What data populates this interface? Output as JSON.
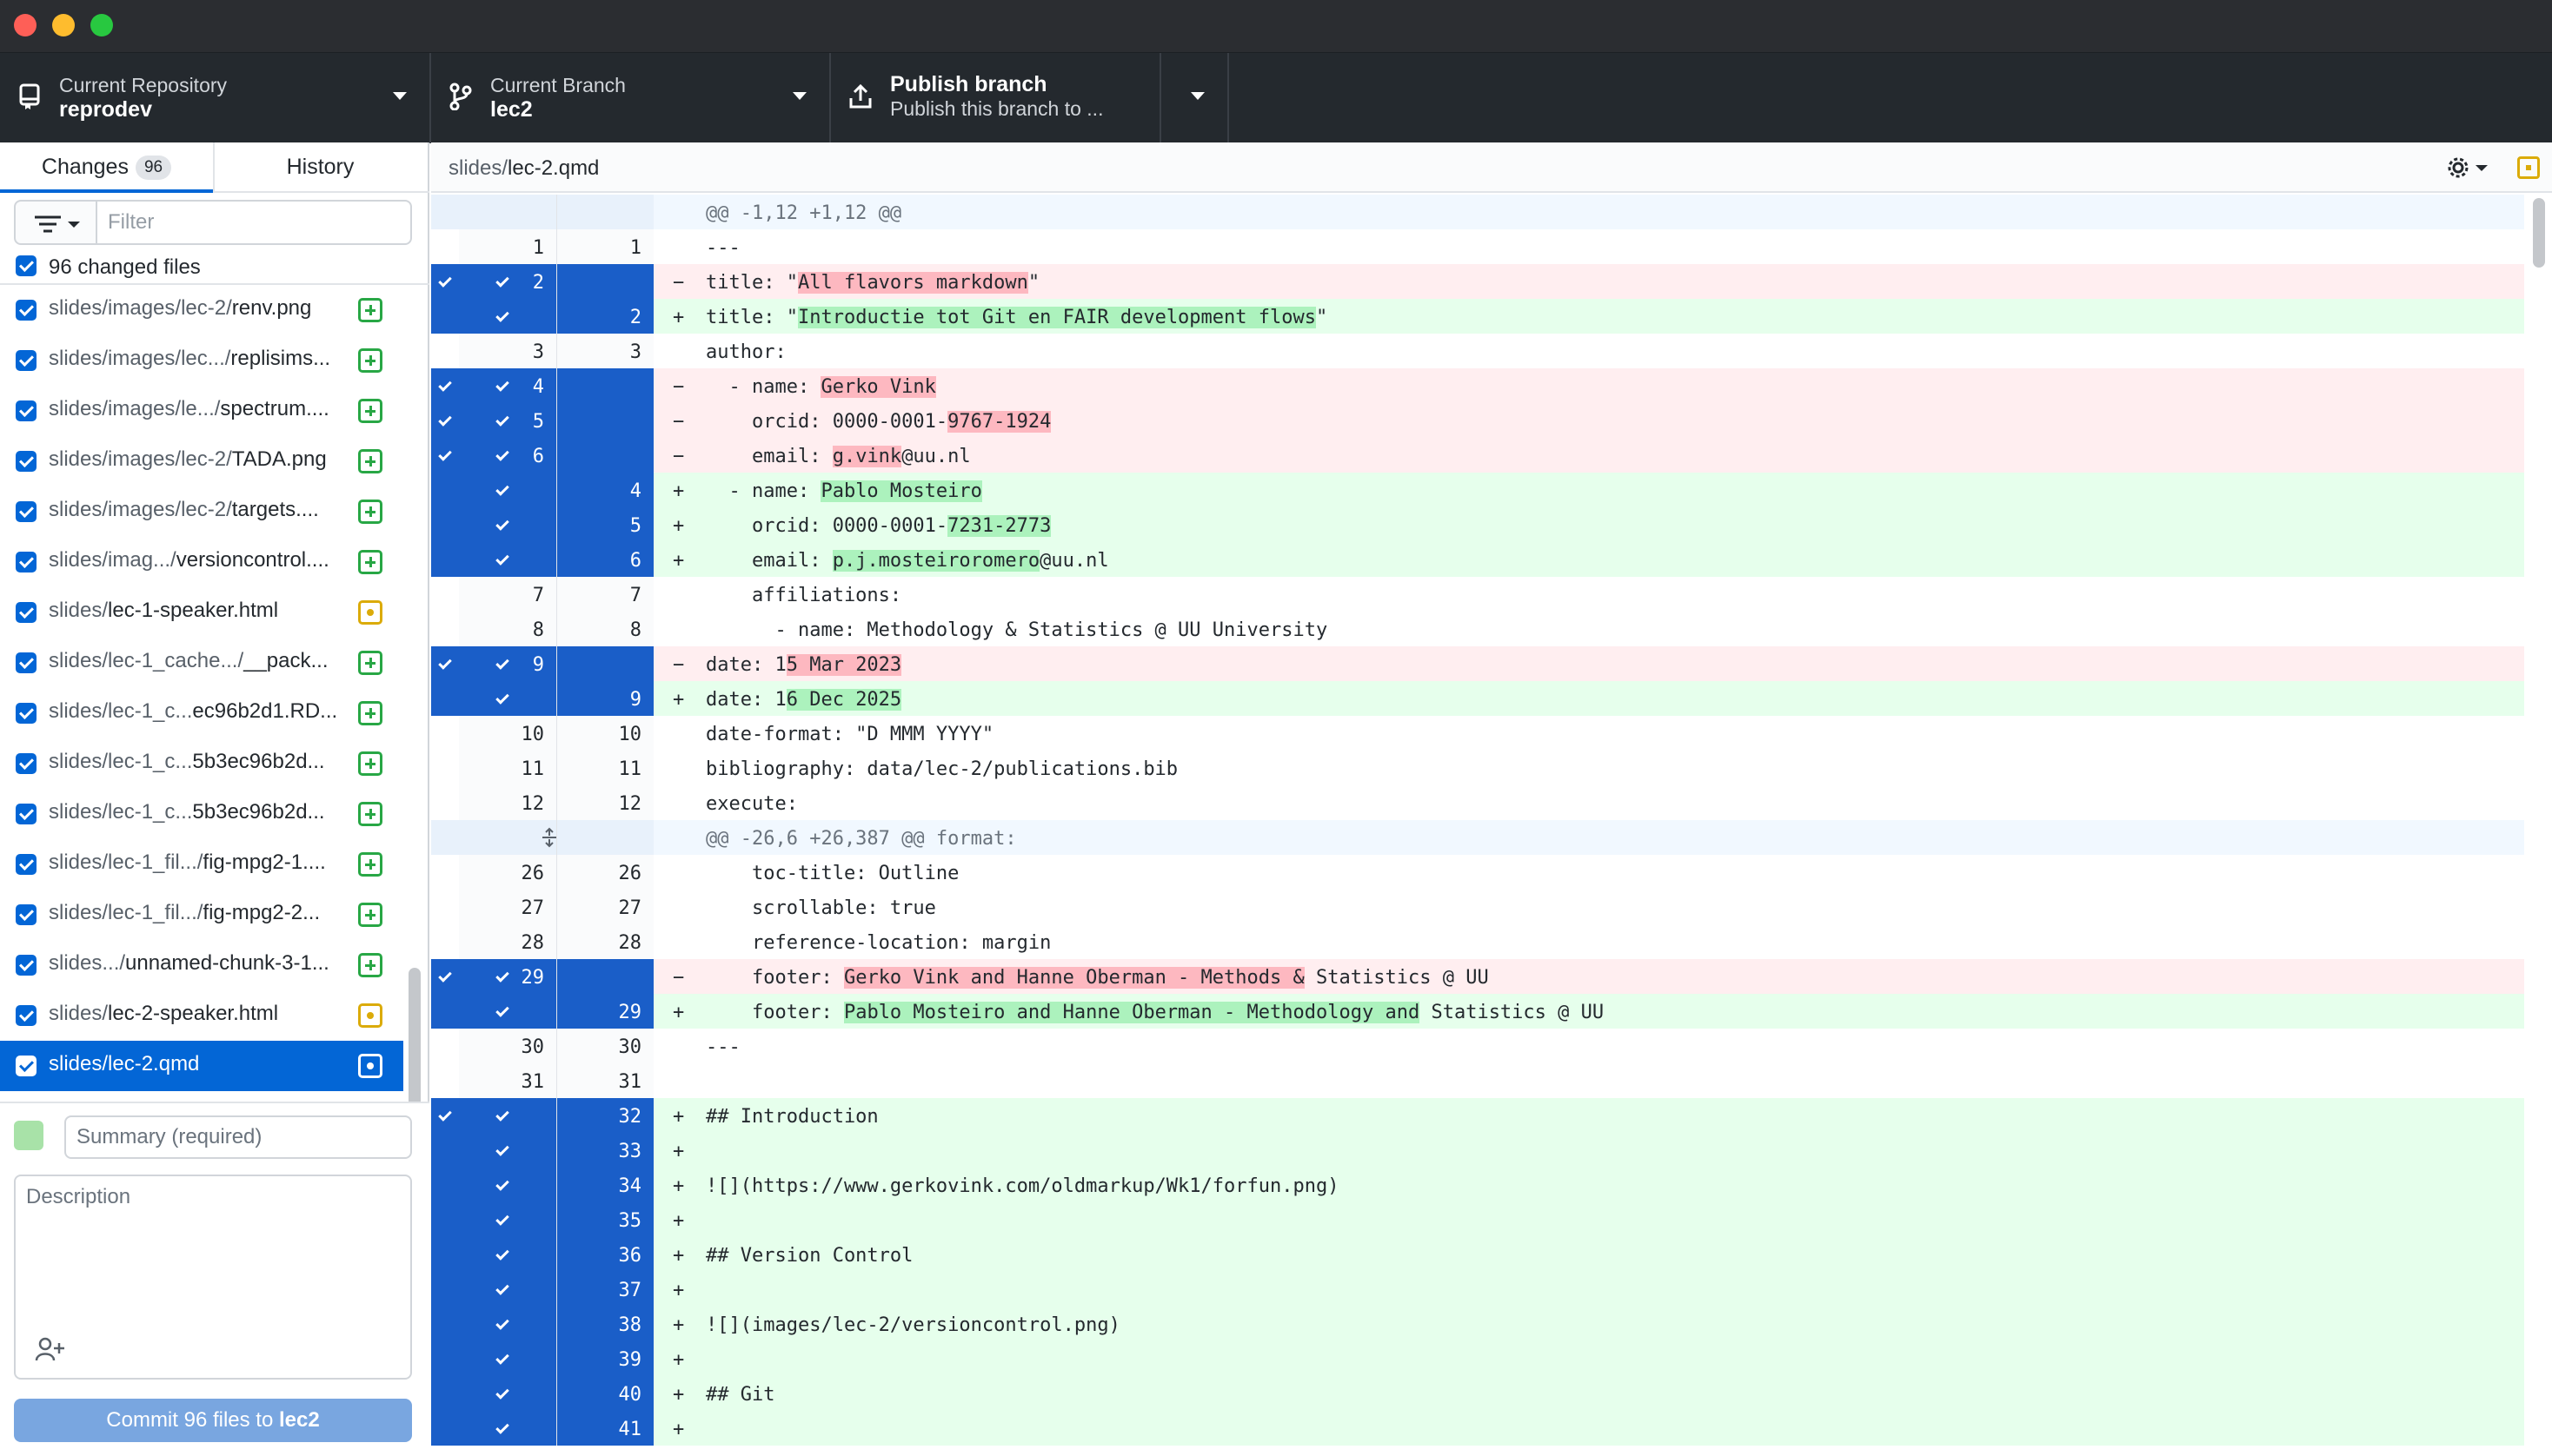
{
  "toolbar": {
    "repo_label": "Current Repository",
    "repo_value": "reprodev",
    "branch_label": "Current Branch",
    "branch_value": "lec2",
    "publish_label": "Publish branch",
    "publish_sub": "Publish this branch to ..."
  },
  "tabs": {
    "changes_label": "Changes",
    "changes_count": "96",
    "history_label": "History"
  },
  "filter": {
    "placeholder": "Filter"
  },
  "all_files_label": "96 changed files",
  "files": [
    {
      "dir": "slides/images/lec-2/",
      "name": "renv.png",
      "status": "added"
    },
    {
      "dir": "slides/images/lec.../",
      "name": "replisims...",
      "status": "added"
    },
    {
      "dir": "slides/images/le.../",
      "name": "spectrum....",
      "status": "added"
    },
    {
      "dir": "slides/images/lec-2/",
      "name": "TADA.png",
      "status": "added"
    },
    {
      "dir": "slides/images/lec-2/",
      "name": "targets....",
      "status": "added"
    },
    {
      "dir": "slides/imag.../",
      "name": "versioncontrol....",
      "status": "added"
    },
    {
      "dir": "slides/",
      "name": "lec-1-speaker.html",
      "status": "modified"
    },
    {
      "dir": "slides/lec-1_cache.../",
      "name": "__pack...",
      "status": "added"
    },
    {
      "dir": "slides/lec-1_c...",
      "name": "ec96b2d1.RD...",
      "status": "added"
    },
    {
      "dir": "slides/lec-1_c...",
      "name": "5b3ec96b2d...",
      "status": "added"
    },
    {
      "dir": "slides/lec-1_c...",
      "name": "5b3ec96b2d...",
      "status": "added"
    },
    {
      "dir": "slides/lec-1_fil.../",
      "name": "fig-mpg2-1....",
      "status": "added"
    },
    {
      "dir": "slides/lec-1_fil.../",
      "name": "fig-mpg2-2...",
      "status": "added"
    },
    {
      "dir": "slides.../",
      "name": "unnamed-chunk-3-1...",
      "status": "added"
    },
    {
      "dir": "slides/",
      "name": "lec-2-speaker.html",
      "status": "modified"
    },
    {
      "dir": "slides/",
      "name": "lec-2.qmd",
      "status": "modified",
      "selected": true
    }
  ],
  "commit": {
    "summary_placeholder": "Summary (required)",
    "description_placeholder": "Description",
    "button_prefix": "Commit 96 files to ",
    "button_branch": "lec2"
  },
  "diff": {
    "path_dir": "slides/",
    "path_file": "lec-2.qmd",
    "lines": [
      {
        "type": "hunk",
        "text": "@@ -1,12 +1,12 @@"
      },
      {
        "type": "ctx",
        "old": "1",
        "new": "1",
        "text": "---"
      },
      {
        "type": "del",
        "old": "2",
        "sel": true,
        "parts": [
          [
            "title: \"",
            ""
          ],
          [
            "All flavors markdown",
            "hl"
          ],
          [
            "\"",
            ""
          ]
        ]
      },
      {
        "type": "add",
        "new": "2",
        "sel": true,
        "parts": [
          [
            "title: \"",
            ""
          ],
          [
            "Introductie tot Git en FAIR development flows",
            "hl"
          ],
          [
            "\"",
            ""
          ]
        ]
      },
      {
        "type": "ctx",
        "old": "3",
        "new": "3",
        "text": "author:"
      },
      {
        "type": "del",
        "old": "4",
        "sel": true,
        "parts": [
          [
            "  - name: ",
            ""
          ],
          [
            "Gerko Vink",
            "hl"
          ]
        ]
      },
      {
        "type": "del",
        "old": "5",
        "sel": true,
        "parts": [
          [
            "    orcid: 0000-0001-",
            ""
          ],
          [
            "9767-1924",
            "hl"
          ]
        ]
      },
      {
        "type": "del",
        "old": "6",
        "sel": true,
        "parts": [
          [
            "    email: ",
            ""
          ],
          [
            "g.vink",
            "hl"
          ],
          [
            "@uu.nl",
            ""
          ]
        ]
      },
      {
        "type": "add",
        "new": "4",
        "sel": true,
        "parts": [
          [
            "  - name: ",
            ""
          ],
          [
            "Pablo Mosteiro",
            "hl"
          ]
        ]
      },
      {
        "type": "add",
        "new": "5",
        "sel": true,
        "parts": [
          [
            "    orcid: 0000-0001-",
            ""
          ],
          [
            "7231-2773",
            "hl"
          ]
        ]
      },
      {
        "type": "add",
        "new": "6",
        "sel": true,
        "parts": [
          [
            "    email: ",
            ""
          ],
          [
            "p.j.mosteiroromero",
            "hl"
          ],
          [
            "@uu.nl",
            ""
          ]
        ]
      },
      {
        "type": "ctx",
        "old": "7",
        "new": "7",
        "text": "    affiliations:"
      },
      {
        "type": "ctx",
        "old": "8",
        "new": "8",
        "text": "      - name: Methodology & Statistics @ UU University"
      },
      {
        "type": "del",
        "old": "9",
        "sel": true,
        "parts": [
          [
            "date: 1",
            ""
          ],
          [
            "5 Mar 2023",
            "hl"
          ]
        ]
      },
      {
        "type": "add",
        "new": "9",
        "sel": true,
        "parts": [
          [
            "date: 1",
            ""
          ],
          [
            "6 Dec 2025",
            "hl"
          ]
        ]
      },
      {
        "type": "ctx",
        "old": "10",
        "new": "10",
        "text": "date-format: \"D MMM YYYY\""
      },
      {
        "type": "ctx",
        "old": "11",
        "new": "11",
        "text": "bibliography: data/lec-2/publications.bib"
      },
      {
        "type": "ctx",
        "old": "12",
        "new": "12",
        "text": "execute:"
      },
      {
        "type": "hunk",
        "expand": true,
        "text": "@@ -26,6 +26,387 @@ format:"
      },
      {
        "type": "ctx",
        "old": "26",
        "new": "26",
        "text": "    toc-title: Outline"
      },
      {
        "type": "ctx",
        "old": "27",
        "new": "27",
        "text": "    scrollable: true"
      },
      {
        "type": "ctx",
        "old": "28",
        "new": "28",
        "text": "    reference-location: margin"
      },
      {
        "type": "del",
        "old": "29",
        "sel": true,
        "parts": [
          [
            "    footer: ",
            ""
          ],
          [
            "Gerko Vink and Hanne Oberman - Methods &",
            "hl"
          ],
          [
            " Statistics @ UU",
            ""
          ]
        ]
      },
      {
        "type": "add",
        "new": "29",
        "sel": true,
        "parts": [
          [
            "    footer: ",
            ""
          ],
          [
            "Pablo Mosteiro and Hanne Oberman - Methodology and",
            "hl"
          ],
          [
            " Statistics @ UU",
            ""
          ]
        ]
      },
      {
        "type": "ctx",
        "old": "30",
        "new": "30",
        "text": "---"
      },
      {
        "type": "ctx",
        "old": "31",
        "new": "31",
        "text": ""
      },
      {
        "type": "add",
        "new": "32",
        "sel": true,
        "text": "## Introduction"
      },
      {
        "type": "add",
        "new": "33",
        "sel": true,
        "text": ""
      },
      {
        "type": "add",
        "new": "34",
        "sel": true,
        "text": "![](https://www.gerkovink.com/oldmarkup/Wk1/forfun.png)"
      },
      {
        "type": "add",
        "new": "35",
        "sel": true,
        "text": ""
      },
      {
        "type": "add",
        "new": "36",
        "sel": true,
        "text": "## Version Control"
      },
      {
        "type": "add",
        "new": "37",
        "sel": true,
        "text": ""
      },
      {
        "type": "add",
        "new": "38",
        "sel": true,
        "text": "![](images/lec-2/versioncontrol.png)"
      },
      {
        "type": "add",
        "new": "39",
        "sel": true,
        "text": ""
      },
      {
        "type": "add",
        "new": "40",
        "sel": true,
        "text": "## Git"
      },
      {
        "type": "add",
        "new": "41",
        "sel": true,
        "text": ""
      }
    ]
  }
}
